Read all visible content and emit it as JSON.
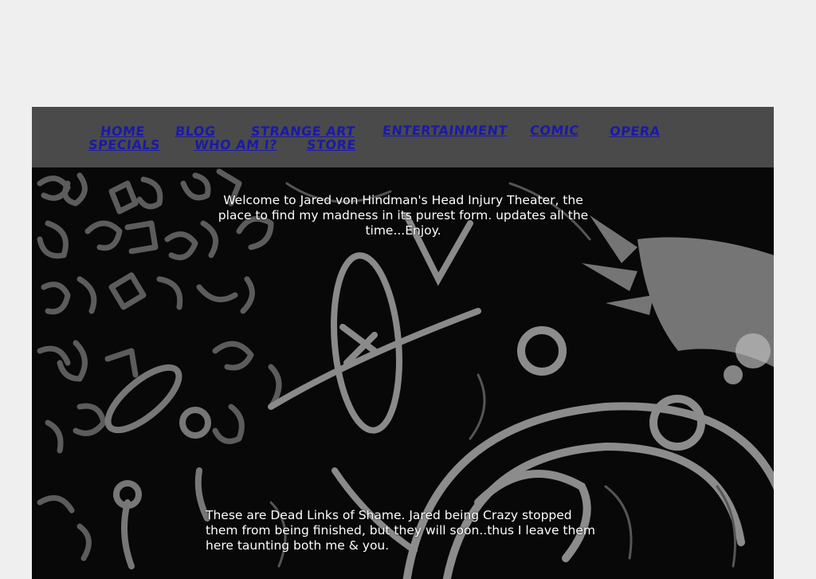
{
  "nav": {
    "home": "Home",
    "blog": "Blog",
    "strange_art": "Strange Art",
    "entertainment": "Entertainment",
    "comic": "Comic",
    "opera": "Opera",
    "specials": "Specials",
    "who_am_i": "Who am I?",
    "store": "Store",
    "link_color": "#1a1aa8"
  },
  "content": {
    "welcome": "Welcome to Jared von Hindman's Head Injury Theater, the place to find my madness in its purest form.  updates all the time...Enjoy.",
    "dead_links": "These are Dead Links of Shame. Jared being Crazy stopped them from being finished, but they will soon..thus I leave them here taunting both me & you."
  },
  "colors": {
    "page_background": "#efefef",
    "navbar_background": "#4a4a4a",
    "art_background": "#080808",
    "art_strokes": "#6e6e6e",
    "body_text": "#ffffff"
  }
}
